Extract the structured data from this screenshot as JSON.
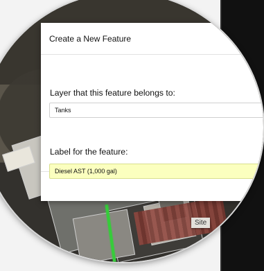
{
  "dialog": {
    "title": "Create a New Feature",
    "layer_label": "Layer that this feature belongs to:",
    "layer_value": "Tanks",
    "feature_label": "Label for the feature:",
    "feature_value": "Diesel AST (1,000 gal)"
  },
  "map": {
    "site_label": "Site"
  },
  "colors": {
    "field_highlight": "#fbffbf",
    "map_path": "#36cc3a"
  }
}
